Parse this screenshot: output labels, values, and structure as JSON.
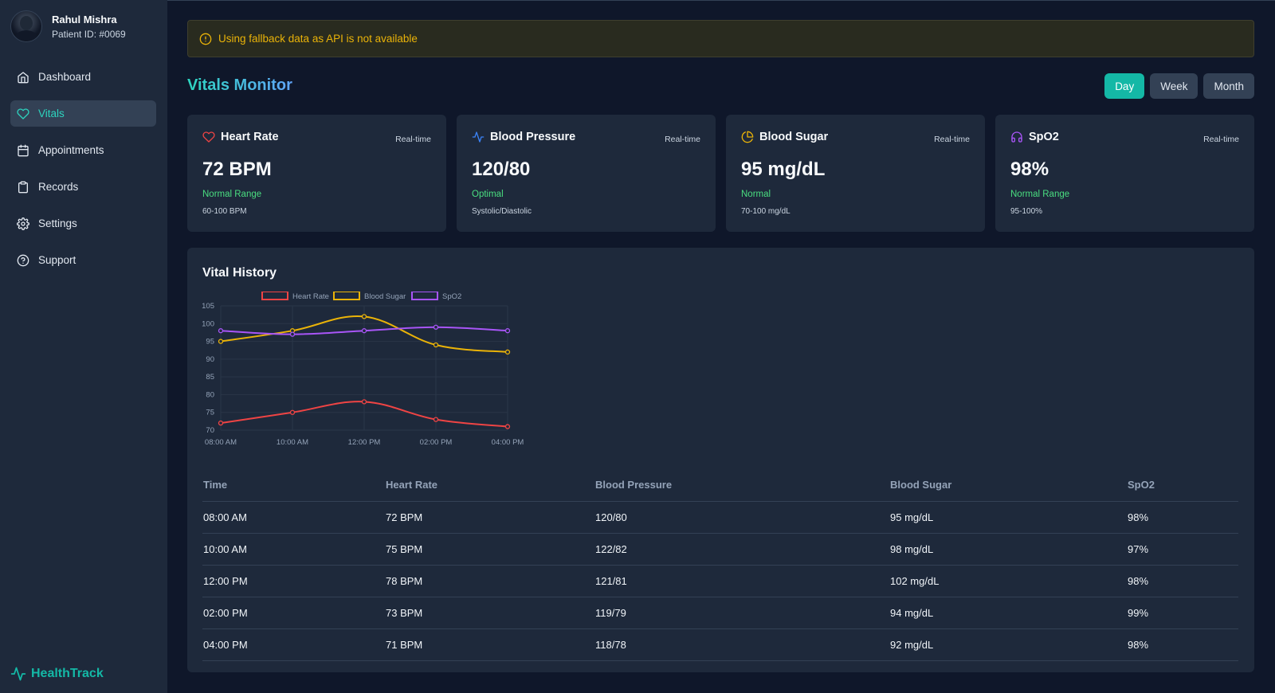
{
  "user": {
    "name": "Rahul Mishra",
    "patient_id": "Patient ID: #0069"
  },
  "sidebar": {
    "items": [
      {
        "label": "Dashboard",
        "icon": "home-icon",
        "active": false
      },
      {
        "label": "Vitals",
        "icon": "heart-icon",
        "active": true
      },
      {
        "label": "Appointments",
        "icon": "calendar-icon",
        "active": false
      },
      {
        "label": "Records",
        "icon": "clipboard-icon",
        "active": false
      },
      {
        "label": "Settings",
        "icon": "gear-icon",
        "active": false
      },
      {
        "label": "Support",
        "icon": "help-circle-icon",
        "active": false
      }
    ],
    "brand": "HealthTrack"
  },
  "alert": {
    "text": "Using fallback data as API is not available",
    "icon": "alert-circle-icon"
  },
  "page": {
    "title": "Vitals Monitor"
  },
  "range": {
    "options": [
      "Day",
      "Week",
      "Month"
    ],
    "selected": "Day"
  },
  "cards": [
    {
      "title": "Heart Rate",
      "tag": "Real-time",
      "value": "72 BPM",
      "status": "Normal Range",
      "range": "60-100 BPM",
      "icon": "heart-icon",
      "color": "#ef4444"
    },
    {
      "title": "Blood Pressure",
      "tag": "Real-time",
      "value": "120/80",
      "status": "Optimal",
      "range": "Systolic/Diastolic",
      "icon": "activity-icon",
      "color": "#3b82f6"
    },
    {
      "title": "Blood Sugar",
      "tag": "Real-time",
      "value": "95 mg/dL",
      "status": "Normal",
      "range": "70-100 mg/dL",
      "icon": "pie-chart-icon",
      "color": "#eab308"
    },
    {
      "title": "SpO2",
      "tag": "Real-time",
      "value": "98%",
      "status": "Normal Range",
      "range": "95-100%",
      "icon": "headphones-icon",
      "color": "#a855f7"
    }
  ],
  "history": {
    "title": "Vital History",
    "columns": [
      "Time",
      "Heart Rate",
      "Blood Pressure",
      "Blood Sugar",
      "SpO2"
    ],
    "rows": [
      [
        "08:00 AM",
        "72 BPM",
        "120/80",
        "95 mg/dL",
        "98%"
      ],
      [
        "10:00 AM",
        "75 BPM",
        "122/82",
        "98 mg/dL",
        "97%"
      ],
      [
        "12:00 PM",
        "78 BPM",
        "121/81",
        "102 mg/dL",
        "98%"
      ],
      [
        "02:00 PM",
        "73 BPM",
        "119/79",
        "94 mg/dL",
        "99%"
      ],
      [
        "04:00 PM",
        "71 BPM",
        "118/78",
        "92 mg/dL",
        "98%"
      ]
    ]
  },
  "chart_data": {
    "type": "line",
    "x": [
      "08:00 AM",
      "10:00 AM",
      "12:00 PM",
      "02:00 PM",
      "04:00 PM"
    ],
    "series": [
      {
        "name": "Heart Rate",
        "values": [
          72,
          75,
          78,
          73,
          71
        ],
        "color": "#ef4444"
      },
      {
        "name": "Blood Sugar",
        "values": [
          95,
          98,
          102,
          94,
          92
        ],
        "color": "#eab308"
      },
      {
        "name": "SpO2",
        "values": [
          98,
          97,
          98,
          99,
          98
        ],
        "color": "#a855f7"
      }
    ],
    "yticks": [
      70,
      75,
      80,
      85,
      90,
      95,
      100,
      105
    ],
    "ylim": [
      70,
      105
    ],
    "grid": true,
    "legend": "top",
    "smooth": true
  }
}
